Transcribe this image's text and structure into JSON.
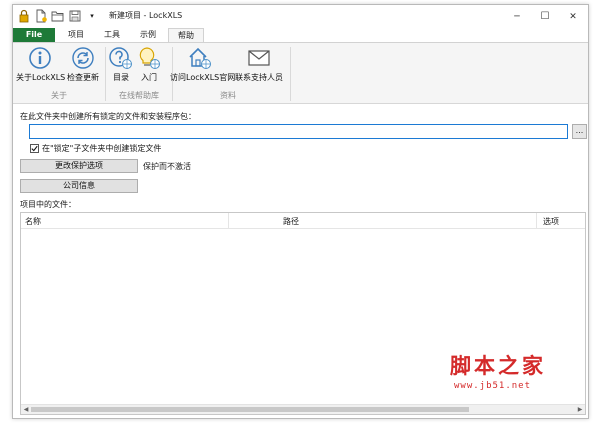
{
  "window": {
    "title": "新建项目 - LockXLS",
    "quick_access_menu_glyph": "▾",
    "controls": {
      "minimize": "─",
      "maximize": "☐",
      "close": "✕"
    },
    "quick_access_icons": [
      "lock-icon",
      "new-file-icon",
      "open-folder-icon",
      "save-icon"
    ]
  },
  "ribbon": {
    "file_tab": "File",
    "tabs": [
      "项目",
      "工具",
      "示例",
      "帮助"
    ],
    "active_tab": "帮助",
    "groups": [
      {
        "label": "关于",
        "buttons": [
          {
            "label": "关于LockXLS",
            "icon": "info-icon"
          },
          {
            "label": "检查更新",
            "icon": "refresh-icon"
          }
        ]
      },
      {
        "label": "在线帮助库",
        "buttons": [
          {
            "label": "目录",
            "icon": "help-globe-icon"
          },
          {
            "label": "入门",
            "icon": "lightbulb-globe-icon"
          }
        ]
      },
      {
        "label": "资料",
        "buttons": [
          {
            "label": "访问LockXLS官网",
            "icon": "home-globe-icon"
          },
          {
            "label": "联系支持人员",
            "icon": "mail-icon"
          }
        ]
      }
    ]
  },
  "content": {
    "folder_label": "在此文件夹中创建所有锁定的文件和安装程序包：",
    "folder_value": "",
    "browse_label": "...",
    "checkbox": {
      "label": "在\"锁定\"子文件夹中创建锁定文件",
      "checked": true
    },
    "change_protection_button": "更改保护选项",
    "protection_status": "保护而不激活",
    "company_info_button": "公司信息",
    "files_label": "项目中的文件：",
    "table": {
      "columns": [
        "名称",
        "路径",
        "选项"
      ],
      "rows": []
    },
    "scroll": {
      "left_arrow": "◀",
      "right_arrow": "▶"
    }
  },
  "watermark": {
    "text": "脚本之家",
    "url": "www.jb51.net"
  },
  "colors": {
    "file_tab": "#1e7a38",
    "input_focus_border": "#1c7ad4",
    "icon_blue": "#3f7fbf",
    "watermark": "#d42a2a"
  }
}
